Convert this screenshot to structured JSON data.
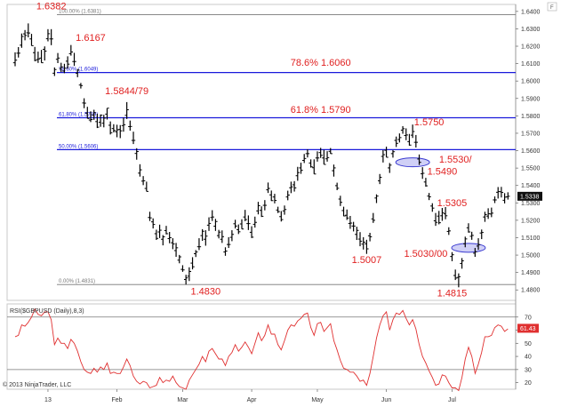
{
  "chart_data": {
    "type": "ohlc",
    "symbol": "GBPUSD",
    "watermark": "© 2013 NinjaTrader, LLC",
    "x_labels": [
      {
        "label": "13",
        "bar": 10
      },
      {
        "label": "Feb",
        "bar": 31
      },
      {
        "label": "Mar",
        "bar": 51
      },
      {
        "label": "Apr",
        "bar": 72
      },
      {
        "label": "May",
        "bar": 92
      },
      {
        "label": "Jun",
        "bar": 113
      },
      {
        "label": "Jul",
        "bar": 133
      }
    ],
    "price_axis": {
      "ylim": [
        1.474,
        1.644
      ],
      "ticks": [
        "1.6400",
        "1.6300",
        "1.6200",
        "1.6100",
        "1.6000",
        "1.5900",
        "1.5800",
        "1.5700",
        "1.5600",
        "1.5500",
        "1.5400",
        "1.5300",
        "1.5200",
        "1.5100",
        "1.5000",
        "1.4900",
        "1.4800"
      ],
      "last_price": "1.5338",
      "grid": false
    },
    "fib_levels": [
      {
        "label": "100.00% (1.6381)",
        "value": 1.6381,
        "color": "#777777",
        "style": "gray"
      },
      {
        "label": "78.60% (1.6049)",
        "value": 1.6049,
        "color": "#1a1adb",
        "style": "blue"
      },
      {
        "label": "61.80% (1.5789)",
        "value": 1.5789,
        "color": "#1a1adb",
        "style": "blue"
      },
      {
        "label": "50.00% (1.5606)",
        "value": 1.5606,
        "color": "#1a1adb",
        "style": "blue"
      },
      {
        "label": "0.00% (1.4831)",
        "value": 1.4831,
        "color": "#777777",
        "style": "gray"
      }
    ],
    "annotations": [
      {
        "text": "1.6382",
        "bar": 11,
        "price": 1.6412
      },
      {
        "text": "1.6167",
        "bar": 23,
        "price": 1.623
      },
      {
        "text": "1.5844/79",
        "bar": 34,
        "price": 1.5925
      },
      {
        "text": "78.6% 1.6060",
        "bar": 93,
        "price": 1.6087
      },
      {
        "text": "61.8% 1.5790",
        "bar": 93,
        "price": 1.5818
      },
      {
        "text": "1.5750",
        "bar": 126,
        "price": 1.5745
      },
      {
        "text": "1.5530/",
        "bar": 134,
        "price": 1.5532
      },
      {
        "text": "1.5490",
        "bar": 130,
        "price": 1.5462
      },
      {
        "text": "1.5305",
        "bar": 133,
        "price": 1.5282
      },
      {
        "text": "1.5007",
        "bar": 107,
        "price": 1.4954
      },
      {
        "text": "1.5030/00",
        "bar": 125,
        "price": 1.499
      },
      {
        "text": "1.4830",
        "bar": 58,
        "price": 1.4773
      },
      {
        "text": "1.4815",
        "bar": 133,
        "price": 1.4762
      }
    ],
    "ellipses": [
      {
        "bar": 121,
        "price": 1.5533
      },
      {
        "bar": 138,
        "price": 1.5042
      }
    ],
    "ohlc": [
      [
        1.6105,
        1.6165,
        1.6085,
        1.612
      ],
      [
        1.616,
        1.6195,
        1.6135,
        1.616
      ],
      [
        1.6206,
        1.6273,
        1.6191,
        1.6256
      ],
      [
        1.6271,
        1.6293,
        1.6234,
        1.6262
      ],
      [
        1.6277,
        1.6331,
        1.6251,
        1.6276
      ],
      [
        1.6242,
        1.6271,
        1.6203,
        1.6203
      ],
      [
        1.6163,
        1.6196,
        1.6114,
        1.6118
      ],
      [
        1.6124,
        1.6169,
        1.6104,
        1.6127
      ],
      [
        1.6132,
        1.6179,
        1.6105,
        1.6105
      ],
      [
        1.6182,
        1.6199,
        1.6118,
        1.6172
      ],
      [
        1.6243,
        1.6298,
        1.6228,
        1.6272
      ],
      [
        1.6242,
        1.6298,
        1.6206,
        1.6242
      ],
      [
        1.6045,
        1.6078,
        1.6029,
        1.6066
      ],
      [
        1.6125,
        1.6161,
        1.6103,
        1.6132
      ],
      [
        1.6072,
        1.6105,
        1.6051,
        1.6081
      ],
      [
        1.6057,
        1.6099,
        1.6045,
        1.6074
      ],
      [
        1.6114,
        1.6142,
        1.6071,
        1.6097
      ],
      [
        1.6157,
        1.6207,
        1.6146,
        1.6167
      ],
      [
        1.6112,
        1.6162,
        1.6087,
        1.6112
      ],
      [
        1.6045,
        1.6069,
        1.6022,
        1.6063
      ],
      [
        1.5977,
        1.5989,
        1.5957,
        1.5974
      ],
      [
        1.5874,
        1.5901,
        1.5844,
        1.5873
      ],
      [
        1.5816,
        1.5852,
        1.5785,
        1.5785
      ],
      [
        1.5776,
        1.5826,
        1.5764,
        1.5779
      ],
      [
        1.5805,
        1.5835,
        1.5777,
        1.5818
      ],
      [
        1.5767,
        1.5812,
        1.573,
        1.5735
      ],
      [
        1.5763,
        1.5808,
        1.5737,
        1.5804
      ],
      [
        1.5758,
        1.5806,
        1.5734,
        1.5787
      ],
      [
        1.581,
        1.5844,
        1.5779,
        1.5844
      ],
      [
        1.5746,
        1.5768,
        1.5693,
        1.5703
      ],
      [
        1.5727,
        1.5752,
        1.5705,
        1.5716
      ],
      [
        1.5709,
        1.5749,
        1.5677,
        1.572
      ],
      [
        1.5722,
        1.5747,
        1.5672,
        1.5714
      ],
      [
        1.5744,
        1.579,
        1.5709,
        1.5749
      ],
      [
        1.5803,
        1.5879,
        1.5782,
        1.5835
      ],
      [
        1.5738,
        1.5773,
        1.5715,
        1.5739
      ],
      [
        1.5659,
        1.5709,
        1.5638,
        1.5659
      ],
      [
        1.5584,
        1.5614,
        1.5548,
        1.5595
      ],
      [
        1.5471,
        1.5522,
        1.5451,
        1.549
      ],
      [
        1.5425,
        1.5454,
        1.5402,
        1.5427
      ],
      [
        1.5383,
        1.5422,
        1.5366,
        1.5366
      ],
      [
        1.5216,
        1.5249,
        1.5196,
        1.5214
      ],
      [
        1.5191,
        1.5211,
        1.5153,
        1.5176
      ],
      [
        1.5123,
        1.5146,
        1.5087,
        1.5096
      ],
      [
        1.5133,
        1.5175,
        1.5098,
        1.5143
      ],
      [
        1.5091,
        1.5115,
        1.5056,
        1.5105
      ],
      [
        1.5141,
        1.5168,
        1.5119,
        1.5123
      ],
      [
        1.5095,
        1.5133,
        1.5068,
        1.51
      ],
      [
        1.5071,
        1.5097,
        1.5034,
        1.5064
      ],
      [
        1.5026,
        1.507,
        1.499,
        1.5042
      ],
      [
        1.4971,
        1.5001,
        1.4953,
        1.499
      ],
      [
        1.4918,
        1.4942,
        1.4904,
        1.4915
      ],
      [
        1.486,
        1.4887,
        1.4831,
        1.4869
      ],
      [
        1.4879,
        1.493,
        1.4851,
        1.4906
      ],
      [
        1.4954,
        1.4988,
        1.4918,
        1.4933
      ],
      [
        1.5008,
        1.5029,
        1.4989,
        1.5018
      ],
      [
        1.5048,
        1.5097,
        1.5029,
        1.5048
      ],
      [
        1.5112,
        1.5149,
        1.5082,
        1.5137
      ],
      [
        1.5091,
        1.5143,
        1.5054,
        1.5109
      ],
      [
        1.5172,
        1.5217,
        1.5139,
        1.5182
      ],
      [
        1.5216,
        1.5258,
        1.5196,
        1.5219
      ],
      [
        1.5166,
        1.5208,
        1.5139,
        1.5193
      ],
      [
        1.5112,
        1.5145,
        1.5096,
        1.5132
      ],
      [
        1.5091,
        1.5142,
        1.507,
        1.5106
      ],
      [
        1.5018,
        1.5045,
        1.4996,
        1.5023
      ],
      [
        1.5061,
        1.5103,
        1.5041,
        1.5061
      ],
      [
        1.5102,
        1.5143,
        1.508,
        1.5119
      ],
      [
        1.518,
        1.5203,
        1.5153,
        1.5167
      ],
      [
        1.5146,
        1.5176,
        1.5121,
        1.5134
      ],
      [
        1.5179,
        1.5206,
        1.515,
        1.515
      ],
      [
        1.5219,
        1.526,
        1.5195,
        1.5204
      ],
      [
        1.5181,
        1.5228,
        1.5144,
        1.5181
      ],
      [
        1.5131,
        1.5166,
        1.5098,
        1.5103
      ],
      [
        1.5177,
        1.5221,
        1.5158,
        1.5188
      ],
      [
        1.5254,
        1.5306,
        1.5234,
        1.5284
      ],
      [
        1.5257,
        1.528,
        1.5219,
        1.5223
      ],
      [
        1.5286,
        1.5316,
        1.5257,
        1.5286
      ],
      [
        1.5375,
        1.5417,
        1.5357,
        1.5383
      ],
      [
        1.5346,
        1.5371,
        1.5311,
        1.5313
      ],
      [
        1.5334,
        1.5352,
        1.5297,
        1.5314
      ],
      [
        1.5259,
        1.5278,
        1.5242,
        1.525
      ],
      [
        1.5221,
        1.5253,
        1.5193,
        1.5204
      ],
      [
        1.5254,
        1.5285,
        1.5232,
        1.5262
      ],
      [
        1.5334,
        1.537,
        1.5315,
        1.5345
      ],
      [
        1.5387,
        1.5422,
        1.5356,
        1.5392
      ],
      [
        1.5404,
        1.5425,
        1.5365,
        1.5386
      ],
      [
        1.5456,
        1.5507,
        1.5427,
        1.5474
      ],
      [
        1.5501,
        1.5531,
        1.5467,
        1.5487
      ],
      [
        1.5544,
        1.5581,
        1.5529,
        1.5555
      ],
      [
        1.5583,
        1.5608,
        1.5561,
        1.5583
      ],
      [
        1.5529,
        1.555,
        1.5503,
        1.5507
      ],
      [
        1.5502,
        1.555,
        1.5466,
        1.5466
      ],
      [
        1.5558,
        1.5596,
        1.5537,
        1.5558
      ],
      [
        1.5589,
        1.5616,
        1.5558,
        1.5573
      ],
      [
        1.5558,
        1.5605,
        1.5521,
        1.5521
      ],
      [
        1.5553,
        1.5597,
        1.5537,
        1.556
      ],
      [
        1.5596,
        1.5615,
        1.5582,
        1.5583
      ],
      [
        1.5485,
        1.552,
        1.5451,
        1.5501
      ],
      [
        1.5399,
        1.5416,
        1.5373,
        1.5384
      ],
      [
        1.5322,
        1.5341,
        1.5282,
        1.5303
      ],
      [
        1.5256,
        1.5278,
        1.5223,
        1.5225
      ],
      [
        1.5229,
        1.5262,
        1.5202,
        1.5213
      ],
      [
        1.5182,
        1.5225,
        1.5151,
        1.5184
      ],
      [
        1.5167,
        1.5191,
        1.5136,
        1.5167
      ],
      [
        1.5119,
        1.5163,
        1.5087,
        1.5142
      ],
      [
        1.5092,
        1.5132,
        1.5051,
        1.508
      ],
      [
        1.5063,
        1.5103,
        1.5032,
        1.5074
      ],
      [
        1.5065,
        1.5088,
        1.5007,
        1.5036
      ],
      [
        1.5111,
        1.5128,
        1.5079,
        1.5105
      ],
      [
        1.5208,
        1.5242,
        1.5185,
        1.52
      ],
      [
        1.5328,
        1.5349,
        1.5299,
        1.5339
      ],
      [
        1.5427,
        1.5466,
        1.5408,
        1.5447
      ],
      [
        1.5567,
        1.5603,
        1.5532,
        1.5577
      ],
      [
        1.5602,
        1.5623,
        1.5562,
        1.5562
      ],
      [
        1.5501,
        1.5529,
        1.5472,
        1.5517
      ],
      [
        1.5583,
        1.5603,
        1.556,
        1.5594
      ],
      [
        1.5659,
        1.5681,
        1.5621,
        1.5642
      ],
      [
        1.5664,
        1.5699,
        1.5647,
        1.5675
      ],
      [
        1.5718,
        1.5741,
        1.5697,
        1.5726
      ],
      [
        1.5687,
        1.5728,
        1.566,
        1.569
      ],
      [
        1.5652,
        1.5696,
        1.5629,
        1.5632
      ],
      [
        1.5689,
        1.575,
        1.5673,
        1.571
      ],
      [
        1.5648,
        1.569,
        1.5618,
        1.5648
      ],
      [
        1.5552,
        1.5578,
        1.5518,
        1.5533
      ],
      [
        1.5467,
        1.5505,
        1.5438,
        1.547
      ],
      [
        1.542,
        1.5444,
        1.5393,
        1.5398
      ],
      [
        1.5339,
        1.5357,
        1.5316,
        1.5335
      ],
      [
        1.5282,
        1.5298,
        1.5249,
        1.527
      ],
      [
        1.5197,
        1.5242,
        1.5168,
        1.5188
      ],
      [
        1.5224,
        1.5254,
        1.5177,
        1.5186
      ],
      [
        1.5226,
        1.5271,
        1.5197,
        1.5244
      ],
      [
        1.5237,
        1.5276,
        1.5206,
        1.5226
      ],
      [
        1.5136,
        1.516,
        1.5116,
        1.5139
      ],
      [
        1.4992,
        1.5017,
        1.4965,
        1.5002
      ],
      [
        1.4883,
        1.4917,
        1.4857,
        1.4868
      ],
      [
        1.4872,
        1.4895,
        1.4815,
        1.4876
      ],
      [
        1.4952,
        1.4983,
        1.4922,
        1.4967
      ],
      [
        1.5065,
        1.5106,
        1.5045,
        1.5093
      ],
      [
        1.5157,
        1.5183,
        1.5129,
        1.5133
      ],
      [
        1.5108,
        1.5134,
        1.5088,
        1.5113
      ],
      [
        1.5011,
        1.5041,
        1.499,
        1.5019
      ],
      [
        1.5052,
        1.5097,
        1.503,
        1.506
      ],
      [
        1.5127,
        1.5147,
        1.5092,
        1.513
      ],
      [
        1.5219,
        1.5249,
        1.5191,
        1.5233
      ],
      [
        1.5224,
        1.5269,
        1.5208,
        1.5238
      ],
      [
        1.5236,
        1.5273,
        1.5218,
        1.5241
      ],
      [
        1.5317,
        1.5337,
        1.5299,
        1.5317
      ],
      [
        1.5361,
        1.5391,
        1.5325,
        1.5365
      ],
      [
        1.5364,
        1.5392,
        1.5331,
        1.536
      ],
      [
        1.5315,
        1.5356,
        1.5297,
        1.5333
      ],
      [
        1.5335,
        1.5361,
        1.5319,
        1.5338
      ]
    ],
    "rsi": {
      "label": "RSI($GBPUSD (Daily),8,3)",
      "ylim": [
        15,
        80
      ],
      "ticks": [
        "70",
        "60",
        "50",
        "40",
        "30",
        "20"
      ],
      "levels": [
        70,
        30
      ],
      "last_value": "61.43",
      "color": "#e03030",
      "values": [
        55,
        56,
        64,
        63,
        66,
        70,
        76,
        72,
        71,
        74,
        74,
        68,
        49,
        54,
        50,
        50,
        46,
        53,
        50,
        44,
        36,
        30,
        28,
        27,
        31,
        28,
        32,
        30,
        35,
        27,
        28,
        27,
        27,
        32,
        38,
        33,
        25,
        21,
        19,
        21,
        20,
        16,
        17,
        18,
        24,
        20,
        22,
        21,
        25,
        20,
        17,
        16,
        15,
        22,
        26,
        30,
        34,
        40,
        36,
        44,
        46,
        42,
        38,
        38,
        33,
        40,
        43,
        49,
        44,
        47,
        51,
        47,
        42,
        50,
        58,
        52,
        56,
        64,
        57,
        57,
        49,
        45,
        52,
        60,
        64,
        63,
        67,
        69,
        72,
        73,
        62,
        56,
        65,
        66,
        59,
        62,
        65,
        52,
        45,
        37,
        31,
        30,
        28,
        28,
        25,
        21,
        22,
        18,
        27,
        40,
        54,
        64,
        71,
        74,
        60,
        68,
        73,
        72,
        75,
        69,
        64,
        68,
        61,
        49,
        40,
        35,
        29,
        24,
        18,
        19,
        26,
        25,
        20,
        16,
        16,
        14,
        24,
        38,
        47,
        40,
        27,
        34,
        43,
        55,
        55,
        56,
        62,
        64,
        63,
        59,
        61
      ]
    }
  }
}
